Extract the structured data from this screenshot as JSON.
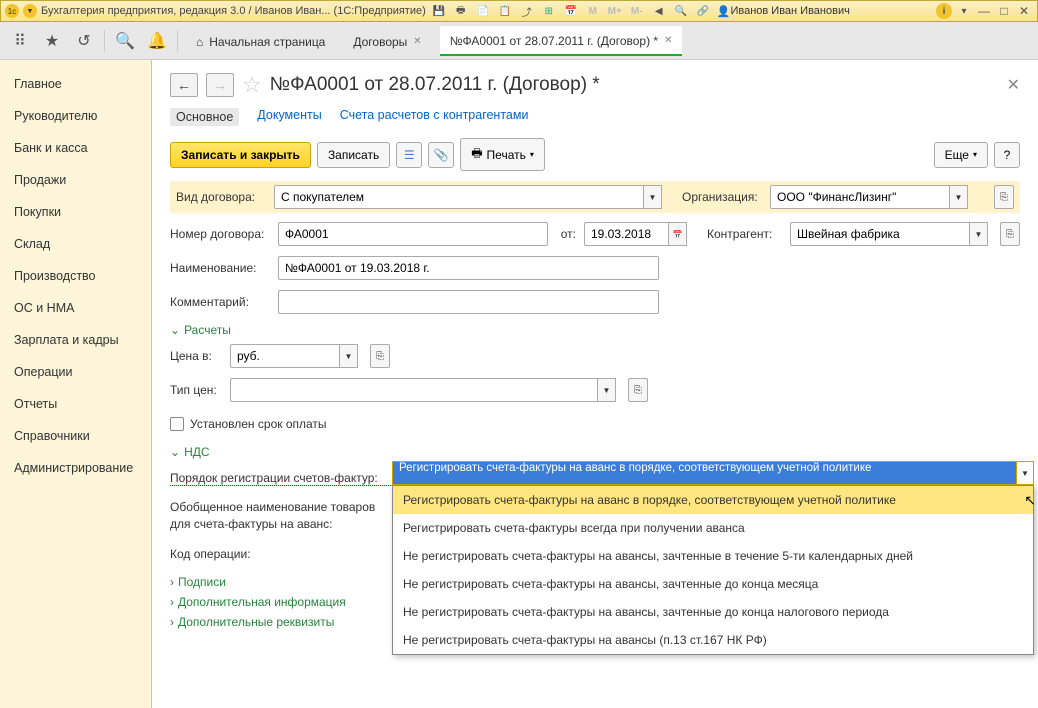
{
  "titlebar": {
    "app_title": "Бухгалтерия предприятия, редакция 3.0 / Иванов Иван...  (1С:Предприятие)",
    "user": "Иванов Иван Иванович",
    "txt_m": "M",
    "txt_mplus": "M+",
    "txt_mminus": "M-"
  },
  "top_tabs": {
    "start": "Начальная страница",
    "contracts": "Договоры",
    "current": "№ФА0001 от 28.07.2011 г. (Договор) *"
  },
  "sidebar": {
    "items": [
      "Главное",
      "Руководителю",
      "Банк и касса",
      "Продажи",
      "Покупки",
      "Склад",
      "Производство",
      "ОС и НМА",
      "Зарплата и кадры",
      "Операции",
      "Отчеты",
      "Справочники",
      "Администрирование"
    ]
  },
  "page": {
    "title": "№ФА0001 от 28.07.2011 г. (Договор) *",
    "inner_tabs": {
      "main": "Основное",
      "docs": "Документы",
      "accounts": "Счета расчетов с контрагентами"
    },
    "toolbar": {
      "save_close": "Записать и закрыть",
      "save": "Записать",
      "print": "Печать",
      "more": "Еще"
    },
    "fields": {
      "contract_type_lbl": "Вид договора:",
      "contract_type_val": "С покупателем",
      "org_lbl": "Организация:",
      "org_val": "ООО \"ФинансЛизинг\"",
      "num_lbl": "Номер договора:",
      "num_val": "ФА0001",
      "from_lbl": "от:",
      "from_val": "19.03.2018",
      "counterparty_lbl": "Контрагент:",
      "counterparty_val": "Швейная фабрика",
      "name_lbl": "Наименование:",
      "name_val": "№ФА0001 от 19.03.2018 г.",
      "comment_lbl": "Комментарий:",
      "calculations": "Расчеты",
      "price_in_lbl": "Цена в:",
      "price_in_val": "руб.",
      "price_type_lbl": "Тип цен:",
      "payment_deadline": "Установлен срок оплаты",
      "vat": "НДС",
      "invoice_order_lbl": "Порядок регистрации счетов-фактур:",
      "invoice_order_val": "Регистрировать счета-фактуры на аванс в порядке, соответствующем учетной политике",
      "generic_name_lbl1": "Обобщенное наименование товаров",
      "generic_name_lbl2": "для счета-фактуры на аванс:",
      "op_code_lbl": "Код операции:",
      "signatures": "Подписи",
      "add_info": "Дополнительная информация",
      "add_props": "Дополнительные реквизиты"
    },
    "dropdown_options": [
      "Регистрировать счета-фактуры на аванс в порядке, соответствующем учетной политике",
      "Регистрировать счета-фактуры всегда при получении аванса",
      "Не регистрировать счета-фактуры на авансы, зачтенные в течение 5-ти календарных дней",
      "Не регистрировать счета-фактуры на авансы, зачтенные до конца месяца",
      "Не регистрировать счета-фактуры на авансы, зачтенные до конца налогового периода",
      "Не регистрировать счета-фактуры на авансы (п.13 ст.167 НК РФ)"
    ]
  }
}
